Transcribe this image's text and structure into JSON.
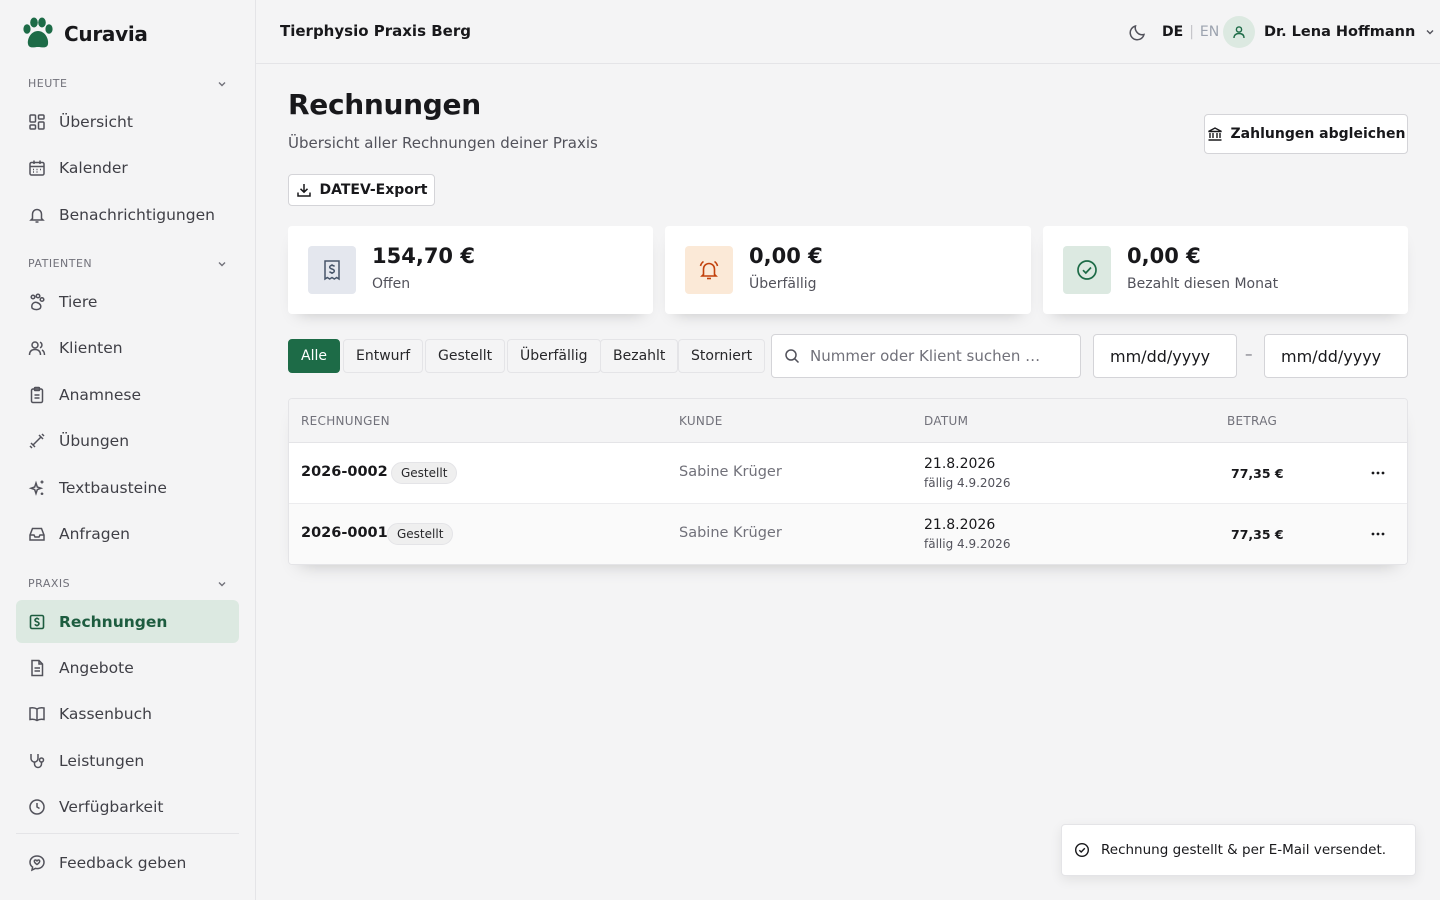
{
  "app": {
    "name": "Curavia"
  },
  "sidebar": {
    "sections": [
      {
        "label": "HEUTE"
      },
      {
        "label": "PATIENTEN"
      },
      {
        "label": "PRAXIS"
      }
    ],
    "items": [
      {
        "label": "Übersicht",
        "icon": "dashboard-icon"
      },
      {
        "label": "Kalender",
        "icon": "calendar-icon"
      },
      {
        "label": "Benachrichtigungen",
        "icon": "bell-icon"
      },
      {
        "label": "Tiere",
        "icon": "paw-icon"
      },
      {
        "label": "Klienten",
        "icon": "users-icon"
      },
      {
        "label": "Anamnese",
        "icon": "clipboard-icon"
      },
      {
        "label": "Übungen",
        "icon": "exercise-icon"
      },
      {
        "label": "Textbausteine",
        "icon": "sparkles-icon"
      },
      {
        "label": "Anfragen",
        "icon": "inbox-icon"
      },
      {
        "label": "Rechnungen",
        "icon": "invoice-icon",
        "active": true
      },
      {
        "label": "Angebote",
        "icon": "document-icon"
      },
      {
        "label": "Kassenbuch",
        "icon": "book-icon"
      },
      {
        "label": "Leistungen",
        "icon": "stethoscope-icon"
      },
      {
        "label": "Verfügbarkeit",
        "icon": "clock-icon"
      }
    ],
    "feedback": "Feedback geben"
  },
  "topbar": {
    "practice": "Tierphysio Praxis Berg",
    "lang_de": "DE",
    "lang_sep": "|",
    "lang_en": "EN",
    "user": "Dr. Lena Hoffmann"
  },
  "page": {
    "title": "Rechnungen",
    "subtitle": "Übersicht aller Rechnungen deiner Praxis",
    "reconcile_button": "Zahlungen abgleichen",
    "export_button": "DATEV-Export"
  },
  "stats": [
    {
      "value": "154,70 €",
      "label": "Offen",
      "color": "#e4e7ee"
    },
    {
      "value": "0,00 €",
      "label": "Überfällig",
      "color": "#fbe9d7"
    },
    {
      "value": "0,00 €",
      "label": "Bezahlt diesen Monat",
      "color": "#dce9e1"
    }
  ],
  "filters": {
    "chips": [
      "Alle",
      "Entwurf",
      "Gestellt",
      "Überfällig",
      "Bezahlt",
      "Storniert"
    ],
    "active": "Alle",
    "search_placeholder": "Nummer oder Klient suchen …",
    "date_from": "mm/dd/yyyy",
    "date_sep": "–",
    "date_to": "mm/dd/yyyy"
  },
  "table": {
    "headers": [
      "RECHNUNGEN",
      "KUNDE",
      "DATUM",
      "BETRAG"
    ],
    "rows": [
      {
        "number": "2026-0002",
        "status": "Gestellt",
        "customer": "Sabine Krüger",
        "date": "21.8.2026",
        "due": "fällig 4.9.2026",
        "amount": "77,35 €"
      },
      {
        "number": "2026-0001",
        "status": "Gestellt",
        "customer": "Sabine Krüger",
        "date": "21.8.2026",
        "due": "fällig 4.9.2026",
        "amount": "77,35 €"
      }
    ]
  },
  "toast": {
    "text": "Rechnung gestellt & per E-Mail versendet."
  },
  "colors": {
    "accent": "#1d6b47",
    "accent_light": "#dce9e1"
  }
}
